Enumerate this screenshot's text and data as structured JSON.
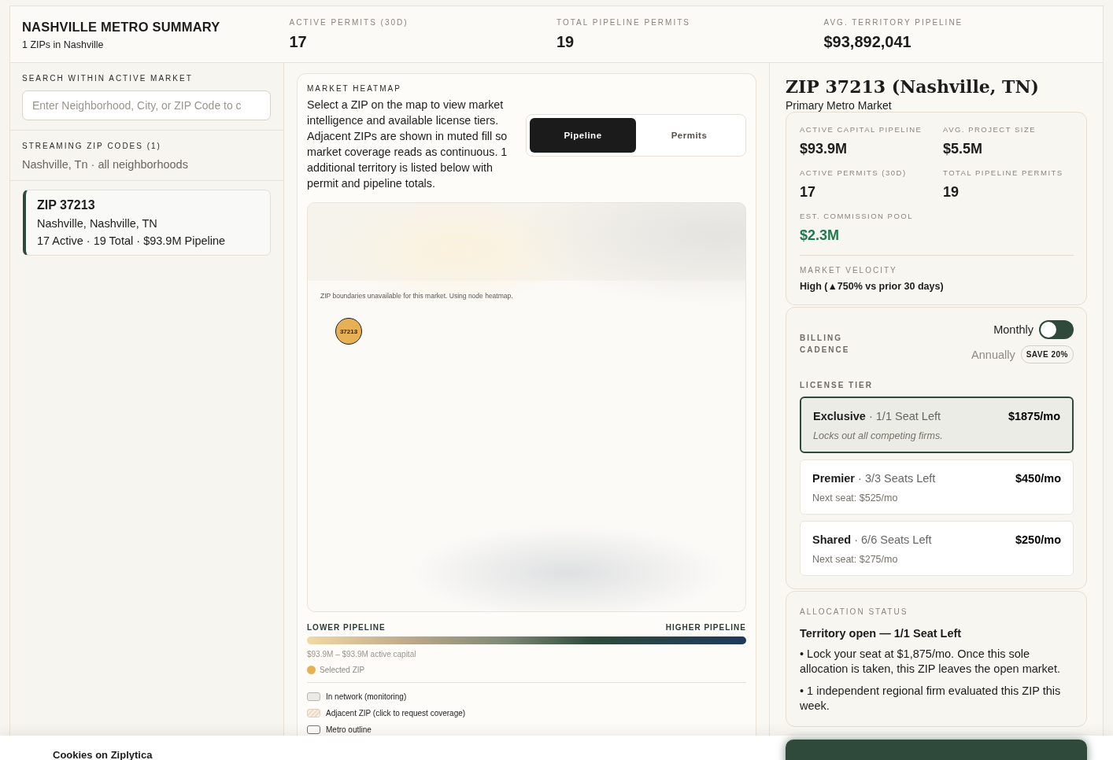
{
  "summary": {
    "title": "NASHVILLE METRO SUMMARY",
    "subtitle": "1 ZIPs in Nashville",
    "stats": [
      {
        "label": "ACTIVE PERMITS (30D)",
        "value": "17"
      },
      {
        "label": "TOTAL PIPELINE PERMITS",
        "value": "19"
      },
      {
        "label": "AVG. TERRITORY PIPELINE",
        "value": "$93,892,041"
      }
    ]
  },
  "search": {
    "label": "SEARCH WITHIN ACTIVE MARKET",
    "placeholder": "Enter Neighborhood, City, or ZIP Code to c"
  },
  "streaming": {
    "label": "STREAMING ZIP CODES (1)",
    "text": "Nashville, Tn · all neighborhoods"
  },
  "zip_list": [
    {
      "title": "ZIP 37213",
      "place": "Nashville, Nashville, TN",
      "totals": "17 Active · 19 Total · $93.9M Pipeline",
      "selected": true
    }
  ],
  "heatmap": {
    "title": "MARKET HEATMAP",
    "description": "Select a ZIP on the map to view market intelligence and available license tiers. Adjacent ZIPs are shown in muted fill so market coverage reads as continuous. 1 additional territory is listed below with permit and pipeline totals.",
    "modes": [
      {
        "label": "Pipeline",
        "selected": true
      },
      {
        "label": "Permits",
        "selected": false
      }
    ],
    "note": "ZIP boundaries unavailable for this market. Using node heatmap.",
    "nodes": [
      {
        "label": "37213",
        "selected": true
      }
    ],
    "scale_low": "LOWER PIPELINE",
    "scale_high": "HIGHER PIPELINE",
    "range": "$93.9M – $93.9M active capital",
    "selected_legend": "Selected ZIP",
    "legend": [
      {
        "kind": "filled",
        "label": "In network (monitoring)"
      },
      {
        "kind": "hatched",
        "label": "Adjacent ZIP (click to request coverage)"
      },
      {
        "kind": "outline",
        "label": "Metro outline"
      }
    ]
  },
  "detail": {
    "title": "ZIP 37213 (Nashville, TN)",
    "subtitle": "Primary Metro Market",
    "stats": [
      {
        "label": "ACTIVE CAPITAL PIPELINE",
        "value": "$93.9M",
        "kind": "plain"
      },
      {
        "label": "AVG. PROJECT SIZE",
        "value": "$5.5M",
        "kind": "plain"
      },
      {
        "label": "ACTIVE PERMITS (30D)",
        "value": "17",
        "kind": "plain"
      },
      {
        "label": "TOTAL PIPELINE PERMITS",
        "value": "19",
        "kind": "plain"
      },
      {
        "label": "EST. COMMISSION POOL",
        "value": "$2.3M",
        "kind": "accent"
      }
    ],
    "velocity_label": "MARKET VELOCITY",
    "velocity": "High (▲750% vs prior 30 days)"
  },
  "billing": {
    "label": "BILLING CADENCE",
    "options": [
      {
        "label": "Monthly",
        "selected": true
      },
      {
        "label": "Annually",
        "selected": false
      }
    ],
    "badge": "SAVE 20%"
  },
  "license": {
    "label": "LICENSE TIER",
    "tiers": [
      {
        "name": "Exclusive",
        "seats": "· 1/1 Seat Left",
        "price": "$1875/mo",
        "note": "Locks out all competing firms.",
        "kind": "italic",
        "selected": true
      },
      {
        "name": "Premier",
        "seats": "· 3/3 Seats Left",
        "price": "$450/mo",
        "note": "Next seat: $525/mo",
        "kind": "plain",
        "selected": false
      },
      {
        "name": "Shared",
        "seats": "· 6/6 Seats Left",
        "price": "$250/mo",
        "note": "Next seat: $275/mo",
        "kind": "plain",
        "selected": false
      }
    ]
  },
  "allocation": {
    "label": "ALLOCATION STATUS",
    "title": "Territory open — 1/1 Seat Left",
    "points": [
      "• Lock your seat at $1,875/mo. Once this sole allocation is taken, this ZIP leaves the open market.",
      "• 1 independent regional firm evaluated this ZIP this week."
    ]
  },
  "cookie": {
    "title": "Cookies on Ziplytica"
  }
}
